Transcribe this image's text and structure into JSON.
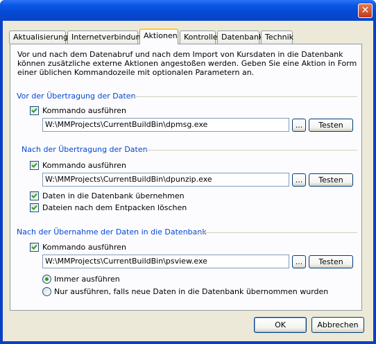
{
  "window": {
    "close_symbol": "✕"
  },
  "tabs": [
    {
      "label": "Aktualisierung"
    },
    {
      "label": "Internetverbindung"
    },
    {
      "label": "Aktionen"
    },
    {
      "label": "Kontrolle"
    },
    {
      "label": "Datenbank"
    },
    {
      "label": "Technik"
    }
  ],
  "intro": "Vor und nach dem Datenabruf und nach dem Import von Kursdaten in die Datenbank können zusätzliche externe Aktionen angestoßen werden. Geben Sie eine Aktion in Form einer üblichen Kommandozeile mit optionalen Parametern an.",
  "group1": {
    "title": "Vor der Übertragung der Daten",
    "run_label": "Kommando ausführen",
    "run_checked": true,
    "command": "W:\\MMProjects\\CurrentBuildBin\\dpmsg.exe",
    "browse_label": "...",
    "test_label": "Testen"
  },
  "group2": {
    "title": "Nach der Übertragung der Daten",
    "run_label": "Kommando ausführen",
    "run_checked": true,
    "command": "W:\\MMProjects\\CurrentBuildBin\\dpunzip.exe",
    "browse_label": "...",
    "test_label": "Testen",
    "import_label": "Daten in die Datenbank übernehmen",
    "import_checked": true,
    "delete_label": "Dateien nach dem Entpacken löschen",
    "delete_checked": true
  },
  "group3": {
    "title": "Nach der Übernahme der Daten in die Datenbank",
    "run_label": "Kommando ausführen",
    "run_checked": true,
    "command": "W:\\MMProjects\\CurrentBuildBin\\psview.exe",
    "browse_label": "...",
    "test_label": "Testen",
    "always_label": "Immer ausführen",
    "conditional_label": "Nur ausführen, falls neue Daten in die Datenbank übernommen wurden",
    "selected_option": "always"
  },
  "footer": {
    "ok_label": "OK",
    "cancel_label": "Abbrechen"
  },
  "colors": {
    "titlebar": "#0a58e6",
    "group_title": "#0046d5",
    "active_tab_accent": "#ffc83c",
    "dialog_bg": "#ece9d8"
  }
}
